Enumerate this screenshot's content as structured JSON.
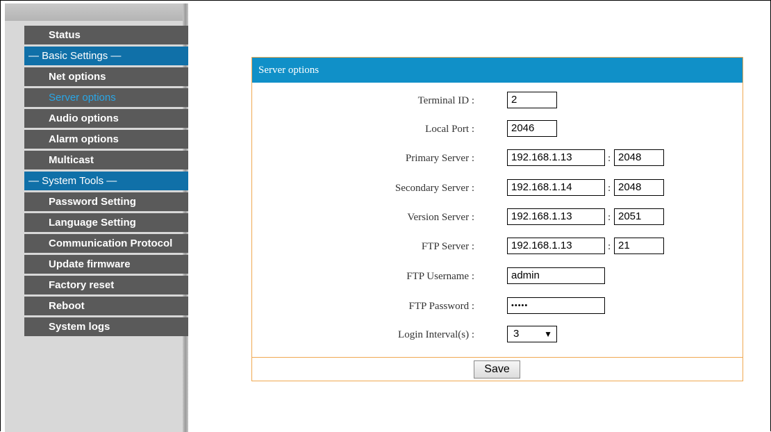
{
  "sidebar": {
    "items": [
      {
        "label": "Status",
        "kind": "item"
      },
      {
        "label": "— Basic Settings —",
        "kind": "section"
      },
      {
        "label": "Net options",
        "kind": "item"
      },
      {
        "label": "Server options",
        "kind": "item",
        "active": true
      },
      {
        "label": "Audio options",
        "kind": "item"
      },
      {
        "label": "Alarm options",
        "kind": "item"
      },
      {
        "label": "Multicast",
        "kind": "item"
      },
      {
        "label": "— System Tools —",
        "kind": "section"
      },
      {
        "label": "Password Setting",
        "kind": "item"
      },
      {
        "label": "Language Setting",
        "kind": "item"
      },
      {
        "label": "Communication Protocol",
        "kind": "item"
      },
      {
        "label": "Update firmware",
        "kind": "item"
      },
      {
        "label": "Factory reset",
        "kind": "item"
      },
      {
        "label": "Reboot",
        "kind": "item"
      },
      {
        "label": "System logs",
        "kind": "item"
      }
    ]
  },
  "panel": {
    "title": "Server options",
    "fields": {
      "terminal_id": {
        "label": "Terminal ID :",
        "value": "2"
      },
      "local_port": {
        "label": "Local Port :",
        "value": "2046"
      },
      "primary_server": {
        "label": "Primary Server :",
        "host": "192.168.1.13",
        "port": "2048"
      },
      "secondary_server": {
        "label": "Secondary Server :",
        "host": "192.168.1.14",
        "port": "2048"
      },
      "version_server": {
        "label": "Version Server :",
        "host": "192.168.1.13",
        "port": "2051"
      },
      "ftp_server": {
        "label": "FTP Server :",
        "host": "192.168.1.13",
        "port": "21"
      },
      "ftp_username": {
        "label": "FTP Username :",
        "value": "admin"
      },
      "ftp_password": {
        "label": "FTP Password :",
        "value": "•••••"
      },
      "login_interval": {
        "label": "Login Interval(s) :",
        "value": "3"
      }
    },
    "colon": ":",
    "save_label": "Save"
  },
  "colors": {
    "menu_item_bg": "#5a5a5a",
    "section_bg": "#1070a8",
    "active_text": "#29a6e6",
    "panel_header_bg": "#1090c8",
    "panel_border": "#f0a850"
  },
  "icons": {
    "dropdown": "triangle-down-icon"
  }
}
